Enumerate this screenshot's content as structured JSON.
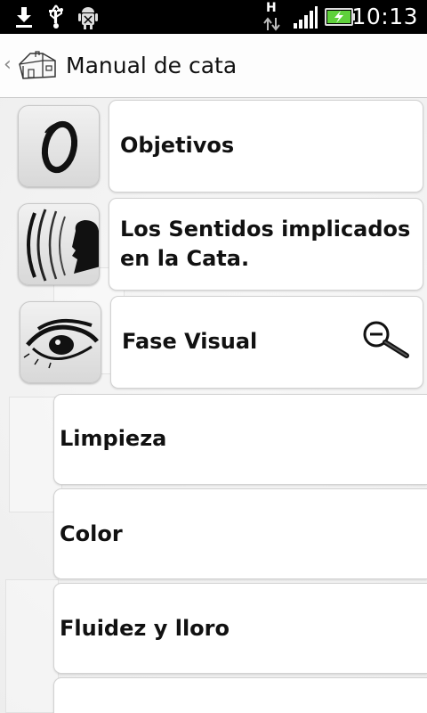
{
  "status_bar": {
    "time": "10:13",
    "network_label": "H",
    "icons": [
      "download-icon",
      "usb-icon",
      "android-debug-icon",
      "data-transfer-icon",
      "signal-icon",
      "battery-charging-icon"
    ]
  },
  "action_bar": {
    "back_glyph": "‹",
    "title": "Manual de cata",
    "app_icon": "house-icon"
  },
  "menu": {
    "items": [
      {
        "label": "Objetivos",
        "icon": "objetivos-icon"
      },
      {
        "label": "Los Sentidos implicados en la Cata.",
        "icon": "senses-icon"
      },
      {
        "label": "Fase Visual",
        "icon": "eye-icon",
        "accessory": "zoom-out-icon"
      }
    ],
    "subitems": [
      {
        "label": "Limpieza"
      },
      {
        "label": "Color"
      },
      {
        "label": "Fluidez y lloro"
      },
      {
        "label": ""
      }
    ]
  },
  "colors": {
    "status_bar_bg": "#000000",
    "battery_green": "#5fd13b",
    "card_bg": "#ffffff",
    "text": "#111111"
  }
}
